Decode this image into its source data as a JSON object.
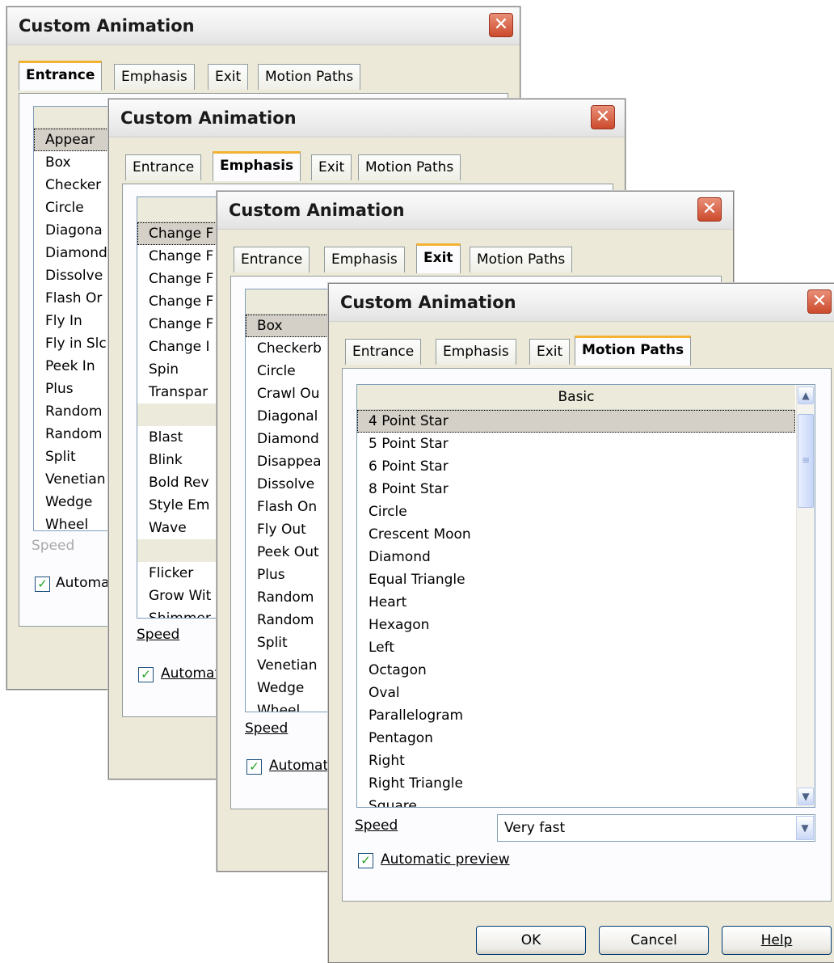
{
  "dialog_title": "Custom Animation",
  "tabs": [
    "Entrance",
    "Emphasis",
    "Exit",
    "Motion Paths"
  ],
  "speed_label": "Speed",
  "auto_preview_label": "Automatic preview",
  "auto_preview_checked": true,
  "dialog1": {
    "active_tab": "Entrance",
    "items": [
      "Appear",
      "Box",
      "Checker",
      "Circle",
      "Diagona",
      "Diamond",
      "Dissolve",
      "Flash Or",
      "Fly In",
      "Fly in Slc",
      "Peek In",
      "Plus",
      "Random",
      "Random",
      "Split",
      "Venetian",
      "Wedge",
      "Wheel"
    ],
    "selected": "Appear"
  },
  "dialog2": {
    "active_tab": "Emphasis",
    "items_group1": [
      "Change F",
      "Change F",
      "Change F",
      "Change F",
      "Change F",
      "Change I",
      "Spin",
      "Transpar"
    ],
    "items_group2": [
      "Blast",
      "Blink",
      "Bold Rev",
      "Style Em",
      "Wave"
    ],
    "items_group3": [
      "Flicker",
      "Grow Wit",
      "Shimmer"
    ],
    "selected": "Change F"
  },
  "dialog3": {
    "active_tab": "Exit",
    "items": [
      "Box",
      "Checkerb",
      "Circle",
      "Crawl Ou",
      "Diagonal",
      "Diamond",
      "Disappea",
      "Dissolve",
      "Flash On",
      "Fly Out",
      "Peek Out",
      "Plus",
      "Random",
      "Random",
      "Split",
      "Venetian",
      "Wedge",
      "Wheel"
    ],
    "selected": "Box"
  },
  "dialog4": {
    "active_tab": "Motion Paths",
    "list_header": "Basic",
    "items": [
      "4 Point Star",
      "5 Point Star",
      "6 Point Star",
      "8 Point Star",
      "Circle",
      "Crescent Moon",
      "Diamond",
      "Equal Triangle",
      "Heart",
      "Hexagon",
      "Left",
      "Octagon",
      "Oval",
      "Parallelogram",
      "Pentagon",
      "Right",
      "Right Triangle",
      "Square"
    ],
    "selected": "4 Point Star",
    "speed_value": "Very fast",
    "buttons": {
      "ok": "OK",
      "cancel": "Cancel",
      "help": "Help"
    }
  },
  "icons": {
    "close": "close-icon",
    "scroll_up": "scroll-up-icon",
    "scroll_down": "scroll-down-icon",
    "dropdown": "chevron-down-icon",
    "check": "checkmark-icon"
  },
  "colors": {
    "close_button": "#cc4a2c",
    "active_tab_accent": "#f4b233",
    "dialog_bg": "#ece9d8"
  }
}
